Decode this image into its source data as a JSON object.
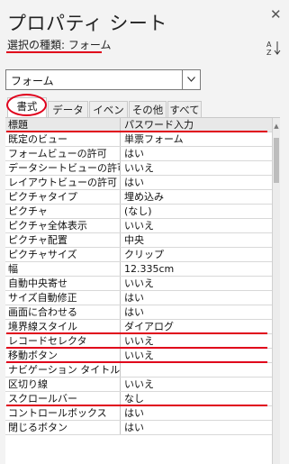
{
  "panel": {
    "title": "プロパティ シート",
    "selection_label": "選択の種類: フォーム",
    "close_glyph": "✕"
  },
  "combo": {
    "value": "フォーム"
  },
  "tabs": [
    {
      "label": "書式",
      "active": true
    },
    {
      "label": "データ",
      "active": false
    },
    {
      "label": "イベント",
      "active": false
    },
    {
      "label": "その他",
      "active": false
    },
    {
      "label": "すべて",
      "active": false
    }
  ],
  "properties": [
    {
      "name": "標題",
      "value": "パスワード入力"
    },
    {
      "name": "既定のビュー",
      "value": "単票フォーム"
    },
    {
      "name": "フォームビューの許可",
      "value": "はい"
    },
    {
      "name": "データシートビューの許可",
      "value": "いいえ"
    },
    {
      "name": "レイアウトビューの許可",
      "value": "はい"
    },
    {
      "name": "ピクチャタイプ",
      "value": "埋め込み"
    },
    {
      "name": "ピクチャ",
      "value": "(なし)"
    },
    {
      "name": "ピクチャ全体表示",
      "value": "いいえ"
    },
    {
      "name": "ピクチャ配置",
      "value": "中央"
    },
    {
      "name": "ピクチャサイズ",
      "value": "クリップ"
    },
    {
      "name": "幅",
      "value": "12.335cm"
    },
    {
      "name": "自動中央寄せ",
      "value": "いいえ"
    },
    {
      "name": "サイズ自動修正",
      "value": "はい"
    },
    {
      "name": "画面に合わせる",
      "value": "はい"
    },
    {
      "name": "境界線スタイル",
      "value": "ダイアログ"
    },
    {
      "name": "レコードセレクタ",
      "value": "いいえ"
    },
    {
      "name": "移動ボタン",
      "value": "いいえ"
    },
    {
      "name": "ナビゲーション タイトル",
      "value": ""
    },
    {
      "name": "区切り線",
      "value": "いいえ"
    },
    {
      "name": "スクロールバー",
      "value": "なし"
    },
    {
      "name": "コントロールボックス",
      "value": "はい"
    },
    {
      "name": "閉じるボタン",
      "value": "はい"
    }
  ],
  "colors": {
    "highlight": "#e0001b"
  }
}
